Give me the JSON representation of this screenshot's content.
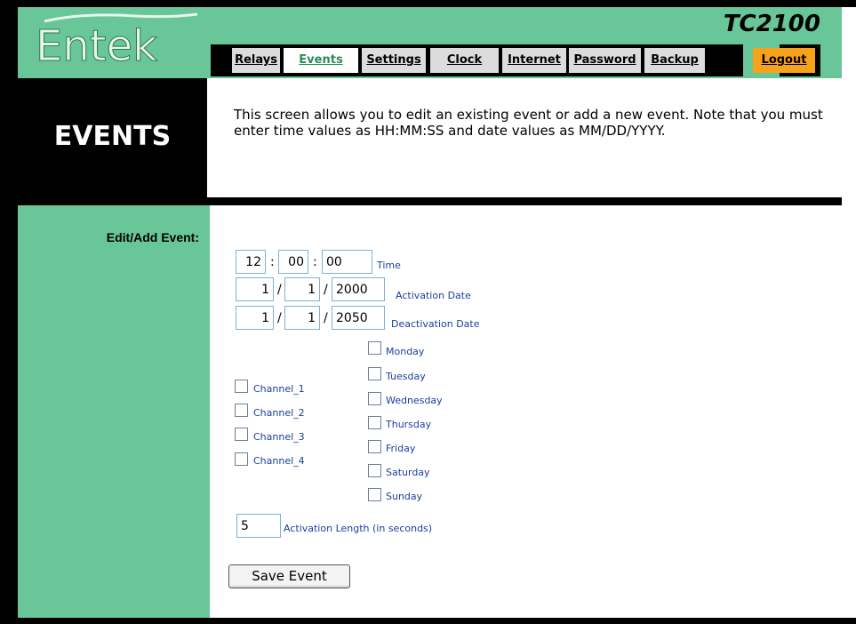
{
  "header": {
    "logo_text": "Entek",
    "model": "TC2100"
  },
  "tabs": [
    {
      "label": "Relays"
    },
    {
      "label": "Events",
      "active": true
    },
    {
      "label": "Settings"
    },
    {
      "label": "Clock"
    },
    {
      "label": "Internet"
    },
    {
      "label": "Password"
    },
    {
      "label": "Backup"
    },
    {
      "label": "Logout"
    }
  ],
  "banner": {
    "title": "EVENTS"
  },
  "description": "This screen allows you to edit an existing event or add a new event. Note that you must enter time values as HH:MM:SS and date values as MM/DD/YYYY.",
  "form": {
    "section_label": "Edit/Add Event:",
    "time": {
      "hours": "12",
      "minutes": "00",
      "seconds": "00",
      "label": "Time",
      "sep": ":"
    },
    "activation_date": {
      "month": "1",
      "day": "1",
      "year": "2000",
      "label": "Activation Date",
      "sep": "/"
    },
    "deactivation_date": {
      "month": "1",
      "day": "1",
      "year": "2050",
      "label": "Deactivation Date",
      "sep": "/"
    },
    "channels": [
      "Channel_1",
      "Channel_2",
      "Channel_3",
      "Channel_4"
    ],
    "days": [
      "Monday",
      "Tuesday",
      "Wednesday",
      "Thursday",
      "Friday",
      "Saturday",
      "Sunday"
    ],
    "activation_length": {
      "value": "5",
      "label": "Activation Length (in seconds)"
    },
    "save_label": "Save Event"
  },
  "colors": {
    "green": "#68c698",
    "logout": "#f7a21b",
    "label_blue": "#1a3f9c"
  }
}
